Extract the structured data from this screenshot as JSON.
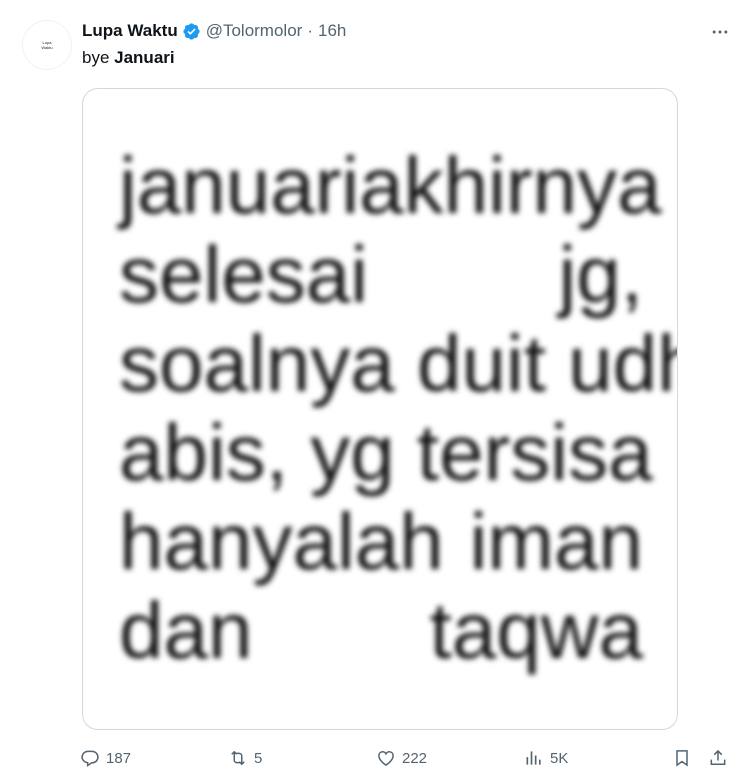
{
  "tweet": {
    "avatar_line1": "Lupa",
    "avatar_line2": "Waktu",
    "display_name": "Lupa Waktu",
    "handle": "@Tolormolor",
    "separator": "·",
    "time": "16h",
    "text_prefix": "bye ",
    "text_bold": "Januari",
    "image_lines": [
      [
        "januari",
        "akhirnya"
      ],
      [
        "selesai",
        "jg,"
      ],
      [
        "soalnya duit udh"
      ],
      [
        "abis, yg tersisa"
      ],
      [
        "hanyalah",
        "iman"
      ],
      [
        "dan",
        "taqwa"
      ]
    ],
    "replies": "187",
    "reposts": "5",
    "likes": "222",
    "views": "5K"
  },
  "icons": {
    "verified": "verified-badge-icon",
    "more": "more-icon",
    "reply": "reply-icon",
    "repost": "repost-icon",
    "like": "heart-icon",
    "views": "views-icon",
    "bookmark": "bookmark-icon",
    "share": "share-icon"
  },
  "colors": {
    "verified": "#1d9bf0",
    "secondary_text": "#536471"
  }
}
